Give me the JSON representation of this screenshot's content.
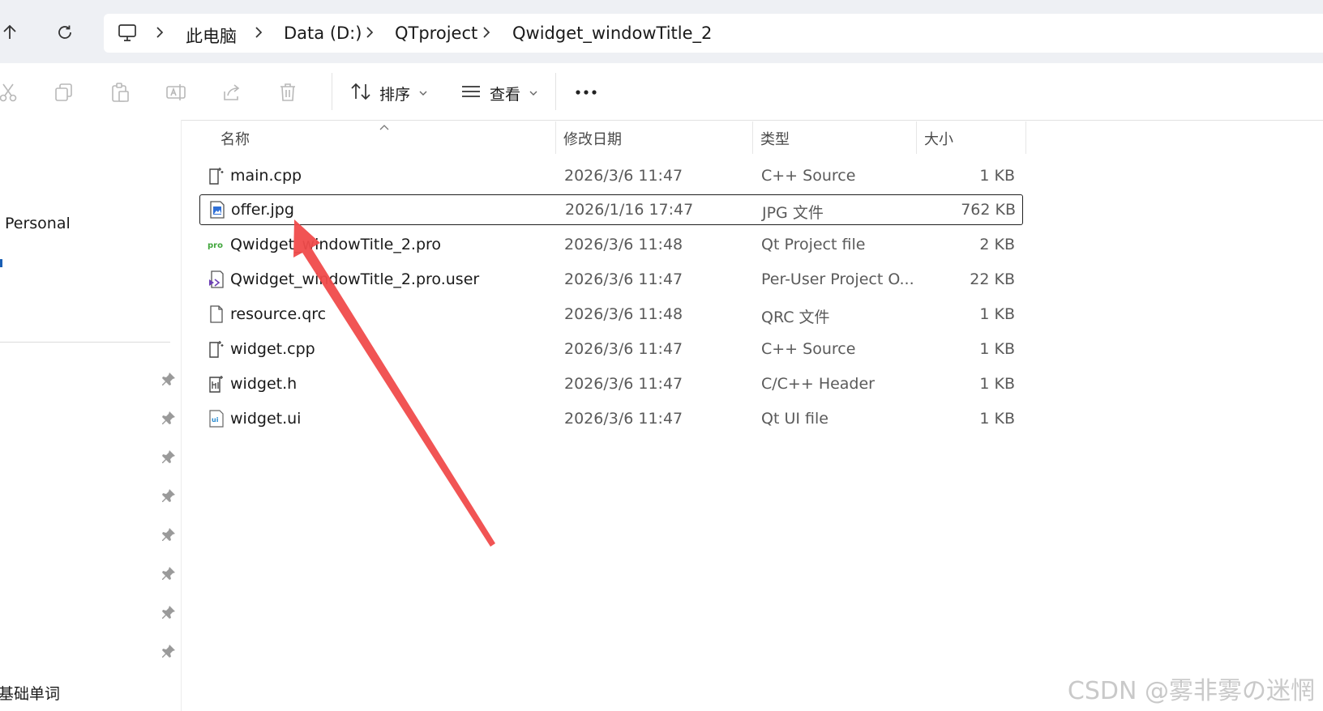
{
  "window": {
    "title": "Qwidget_windowTitle_2"
  },
  "breadcrumb": [
    "此电脑",
    "Data (D:)",
    "QTproject",
    "Qwidget_windowTitle_2"
  ],
  "command_bar": {
    "sort_label": "排序",
    "view_label": "查看"
  },
  "sidebar": {
    "items": [
      {
        "label": "Personal"
      },
      {
        "label": "基础单词"
      }
    ],
    "pinned_count": 8
  },
  "file_list": {
    "columns": {
      "name": "名称",
      "date": "修改日期",
      "type": "类型",
      "size": "大小"
    },
    "rows": [
      {
        "name": "main.cpp",
        "date": "2026/3/6 11:47",
        "type": "C++ Source",
        "size": "1 KB",
        "icon": "cpp-file-icon",
        "selected": false
      },
      {
        "name": "offer.jpg",
        "date": "2026/1/16 17:47",
        "type": "JPG 文件",
        "size": "762 KB",
        "icon": "image-file-icon",
        "selected": true
      },
      {
        "name": "Qwidget_windowTitle_2.pro",
        "date": "2026/3/6 11:48",
        "type": "Qt Project file",
        "size": "2 KB",
        "icon": "pro-file-icon",
        "selected": false
      },
      {
        "name": "Qwidget_windowTitle_2.pro.user",
        "date": "2026/3/6 11:47",
        "type": "Per-User Project O...",
        "size": "22 KB",
        "icon": "user-file-icon",
        "selected": false
      },
      {
        "name": "resource.qrc",
        "date": "2026/3/6 11:48",
        "type": "QRC 文件",
        "size": "1 KB",
        "icon": "blank-file-icon",
        "selected": false
      },
      {
        "name": "widget.cpp",
        "date": "2026/3/6 11:47",
        "type": "C++ Source",
        "size": "1 KB",
        "icon": "cpp-file-icon",
        "selected": false
      },
      {
        "name": "widget.h",
        "date": "2026/3/6 11:47",
        "type": "C/C++ Header",
        "size": "1 KB",
        "icon": "header-file-icon",
        "selected": false
      },
      {
        "name": "widget.ui",
        "date": "2026/3/6 11:47",
        "type": "Qt UI file",
        "size": "1 KB",
        "icon": "ui-file-icon",
        "selected": false
      }
    ]
  },
  "watermark": {
    "text": "CSDN @雾非雾の迷惘"
  },
  "colors": {
    "arrow": "#f04b4b",
    "selection_border": "#1f1f1f",
    "address_band": "#eef0f4"
  }
}
